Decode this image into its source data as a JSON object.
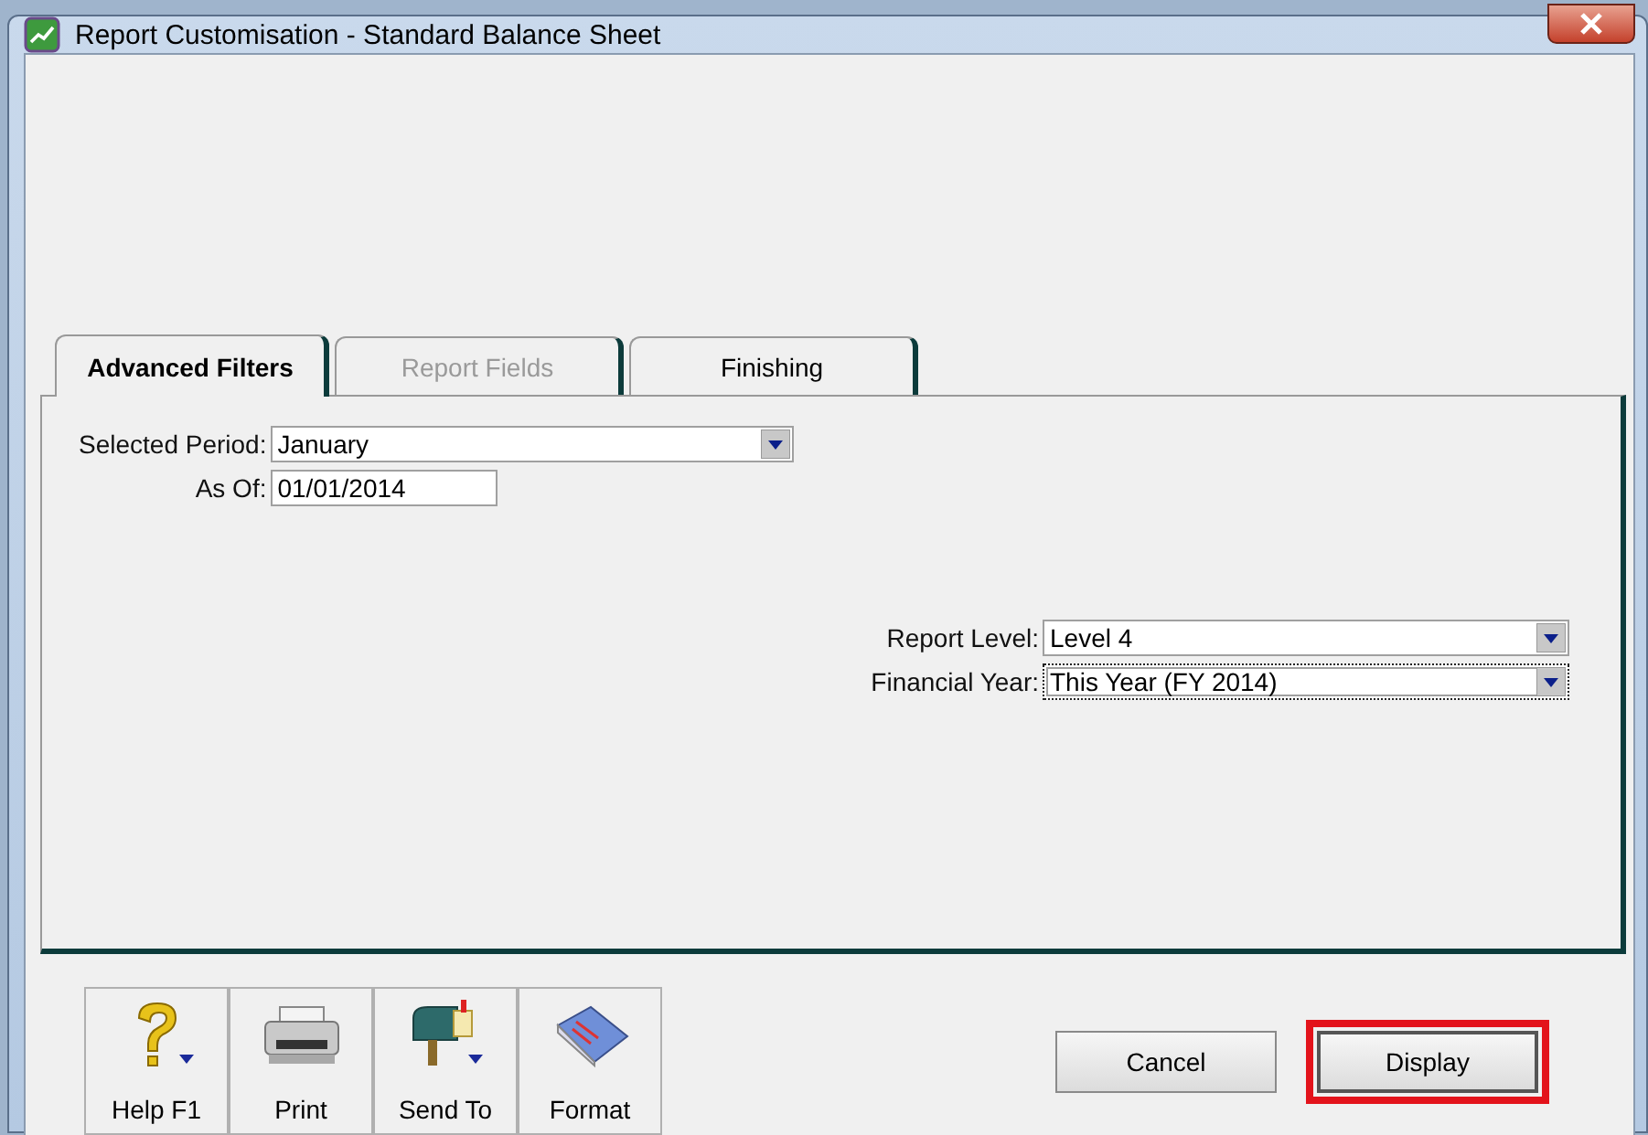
{
  "window": {
    "title": "Report Customisation - Standard Balance Sheet"
  },
  "tabs": [
    {
      "label": "Advanced Filters",
      "selected": true,
      "disabled": false
    },
    {
      "label": "Report Fields",
      "selected": false,
      "disabled": true
    },
    {
      "label": "Finishing",
      "selected": false,
      "disabled": false
    }
  ],
  "left_fields": [
    {
      "label": "Selected Period:",
      "kind": "dropdown",
      "value": "January",
      "focused": false
    },
    {
      "label": "As Of:",
      "kind": "text",
      "value": "01/01/2014",
      "focused": false
    }
  ],
  "right_fields": [
    {
      "label": "Report Level:",
      "kind": "dropdown",
      "value": "Level 4",
      "focused": false
    },
    {
      "label": "Financial Year:",
      "kind": "dropdown",
      "value": "This Year (FY 2014)",
      "focused": true
    }
  ],
  "toolbar": [
    {
      "label": "Help F1",
      "kind": "help"
    },
    {
      "label": "Print",
      "kind": "print"
    },
    {
      "label": "Send To",
      "kind": "mailbox"
    },
    {
      "label": "Format",
      "kind": "book"
    }
  ],
  "buttons": [
    {
      "label": "Cancel",
      "highlighted": false
    },
    {
      "label": "Display",
      "highlighted": true
    }
  ]
}
